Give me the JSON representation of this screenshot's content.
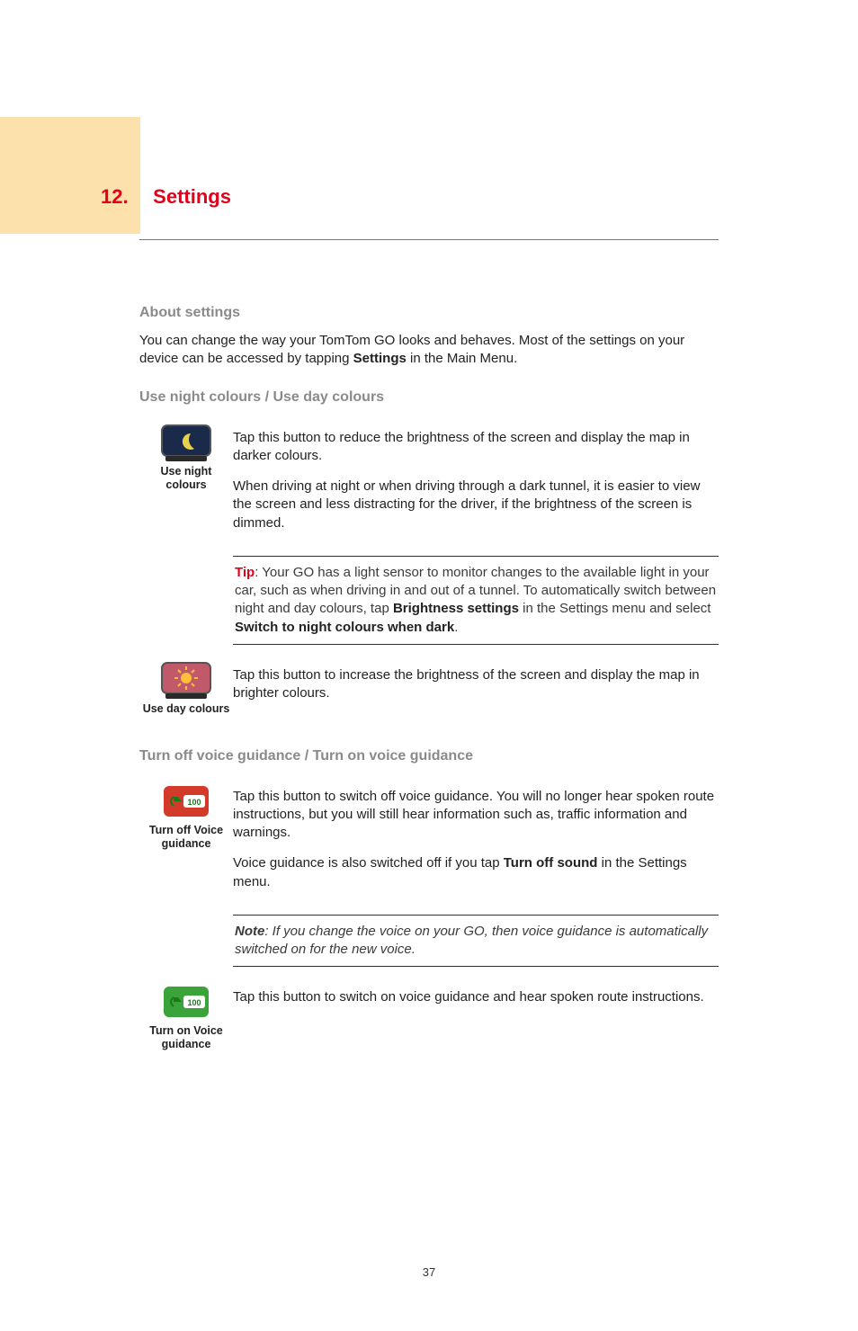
{
  "chapter": {
    "number": "12.",
    "title": "Settings"
  },
  "sections": {
    "about": {
      "heading": "About settings",
      "body_pre": "You can change the way your TomTom GO looks and behaves. Most of the settings on your device can be accessed by tapping ",
      "body_bold": "Settings",
      "body_post": " in the Main Menu."
    },
    "colours": {
      "heading": "Use night colours / Use day colours",
      "night": {
        "icon_label": "Use night colours",
        "p1": "Tap this button to reduce the brightness of the screen and display the map in darker colours.",
        "p2": "When driving at night or when driving through a dark tunnel, it is easier to view the screen and less distracting for the driver, if the brightness of the screen is dimmed."
      },
      "tip": {
        "label": "Tip",
        "pre": ": Your GO has a light sensor to monitor changes to the available light in your car, such as when driving in and out of a tunnel. To automatically switch between night and day colours, tap ",
        "bold1": "Brightness settings",
        "mid": " in the Settings menu and select ",
        "bold2": "Switch to night colours when dark",
        "post": "."
      },
      "day": {
        "icon_label": "Use day colours",
        "p1": "Tap this button to increase the brightness of the screen and display the map in brighter colours."
      }
    },
    "voice": {
      "heading": "Turn off voice guidance / Turn on voice guidance",
      "off": {
        "icon_label": "Turn off Voice guidance",
        "p1": "Tap this button to switch off voice guidance. You will no longer hear spoken route instructions, but you will still hear information such as, traffic information and warnings.",
        "p2_pre": "Voice guidance is also switched off if you tap ",
        "p2_bold": "Turn off sound",
        "p2_post": " in the Settings menu."
      },
      "note": {
        "label": "Note",
        "body": ": If you change the voice on your GO, then voice guidance is automatically switched on for the new voice."
      },
      "on": {
        "icon_label": "Turn on Voice guidance",
        "p1": "Tap this button to switch on voice guidance and hear spoken route instructions."
      }
    }
  },
  "page_number": "37"
}
